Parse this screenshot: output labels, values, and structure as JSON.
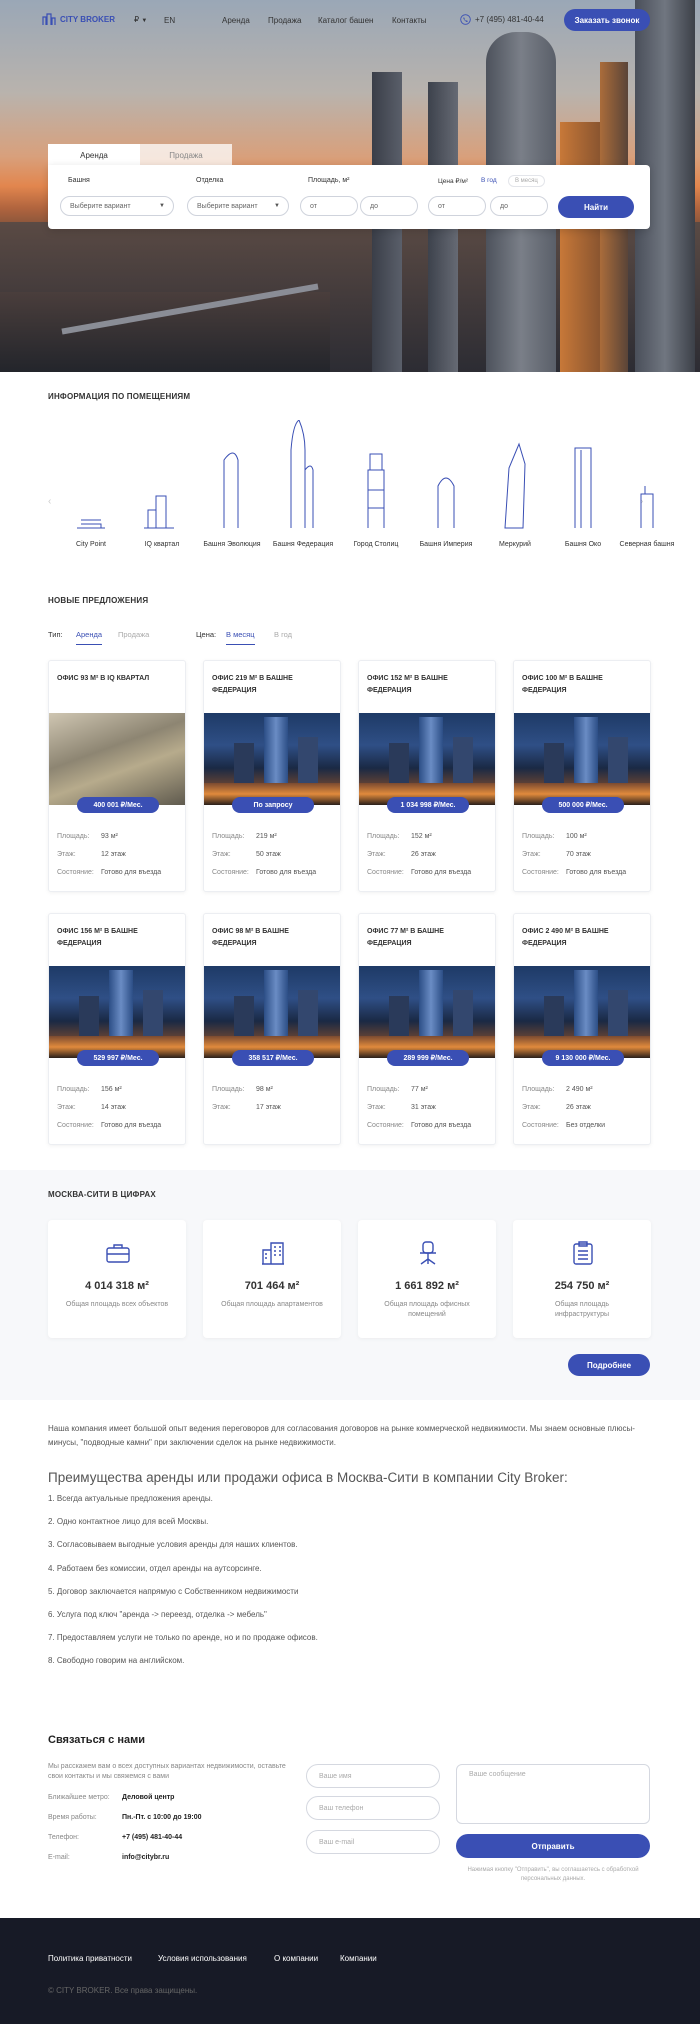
{
  "header": {
    "logo": "CITY BROKER",
    "lang": "EN",
    "nav": [
      "Аренда",
      "Продажа",
      "Каталог башен",
      "Контакты"
    ],
    "phone": "+7 (495) 481-40-44",
    "cta": "Заказать звонок"
  },
  "search": {
    "tabs": [
      "Аренда",
      "Продажа"
    ],
    "labels": {
      "tower": "Башня",
      "finish": "Отделка",
      "area": "Площадь, м²",
      "price": "Цена ₽/м²",
      "per_month": "В год",
      "per_year": "В месяц"
    },
    "placeholders": {
      "select": "Выберите вариант",
      "from": "от",
      "to": "до"
    },
    "submit": "Найти"
  },
  "towers": {
    "title": "ИНФОРМАЦИЯ ПО ПОМЕЩЕНИЯМ",
    "items": [
      "City Point",
      "IQ квартал",
      "Башня Эволюция",
      "Башня Федерация",
      "Город Столиц",
      "Башня Империя",
      "Меркурий",
      "Башня Око",
      "Северная башня"
    ]
  },
  "offers": {
    "title": "НОВЫЕ ПРЕДЛОЖЕНИЯ",
    "type_label": "Тип:",
    "type_tabs": [
      "Аренда",
      "Продажа"
    ],
    "price_label": "Цена:",
    "price_tabs": [
      "В месяц",
      "В год"
    ],
    "labels": {
      "area": "Площадь:",
      "floor": "Этаж:",
      "state": "Состояние:"
    },
    "cards": [
      {
        "title": "ОФИС 93 М² В IQ КВАРТАЛ",
        "price": "400 001 ₽/Мес.",
        "area": "93 м²",
        "floor": "12 этаж",
        "state": "Готово для въезда"
      },
      {
        "title": "ОФИС 219 М² В БАШНЕ ФЕДЕРАЦИЯ",
        "price": "По запросу",
        "area": "219 м²",
        "floor": "50 этаж",
        "state": "Готово для въезда"
      },
      {
        "title": "ОФИС 152 М² В БАШНЕ ФЕДЕРАЦИЯ",
        "price": "1 034 998 ₽/Мес.",
        "area": "152 м²",
        "floor": "26 этаж",
        "state": "Готово для въезда"
      },
      {
        "title": "ОФИС 100 М² В БАШНЕ ФЕДЕРАЦИЯ",
        "price": "500 000 ₽/Мес.",
        "area": "100 м²",
        "floor": "70 этаж",
        "state": "Готово для въезда"
      },
      {
        "title": "ОФИС 156 М² В БАШНЕ ФЕДЕРАЦИЯ",
        "price": "529 997 ₽/Мес.",
        "area": "156 м²",
        "floor": "14 этаж",
        "state": "Готово для въезда"
      },
      {
        "title": "ОФИС 98 М² В БАШНЕ ФЕДЕРАЦИЯ",
        "price": "358 517 ₽/Мес.",
        "area": "98 м²",
        "floor": "17 этаж",
        "state": ""
      },
      {
        "title": "ОФИС 77 М² В БАШНЕ ФЕДЕРАЦИЯ",
        "price": "289 999 ₽/Мес.",
        "area": "77 м²",
        "floor": "31 этаж",
        "state": "Готово для въезда"
      },
      {
        "title": "ОФИС 2 490 М² В БАШНЕ ФЕДЕРАЦИЯ",
        "price": "9 130 000 ₽/Мес.",
        "area": "2 490 м²",
        "floor": "26 этаж",
        "state": "Без отделки"
      }
    ]
  },
  "stats": {
    "title": "МОСКВА-СИТИ В ЦИФРАХ",
    "items": [
      {
        "value": "4 014 318 м²",
        "desc": "Общая площадь всех объектов"
      },
      {
        "value": "701 464 м²",
        "desc": "Общая площадь апартаментов"
      },
      {
        "value": "1 661 892 м²",
        "desc": "Общая площадь офисных помещений"
      },
      {
        "value": "254 750 м²",
        "desc": "Общая площадь инфраструктуры"
      }
    ],
    "more": "Подробнее"
  },
  "about": {
    "intro": "Наша компания имеет большой опыт ведения переговоров для согласования договоров на рынке коммерческой недвижимости. Мы знаем основные плюсы-минусы, \"подводные камни\" при заключении сделок на рынке недвижимости.",
    "heading": "Преимущества аренды или продажи офиса в Москва-Сити в компании City Broker:",
    "list": [
      "1. Всегда актуальные предложения аренды.",
      "2. Одно контактное лицо для всей Москвы.",
      "3. Согласовываем выгодные условия аренды для наших клиентов.",
      "4. Работаем без комиссии, отдел аренды на аутсорсинге.",
      "5. Договор заключается напрямую с Собственником недвижимости",
      "6. Услуга под ключ \"аренда -> переезд, отделка -> мебель\"",
      "7. Предоставляем услуги не только по аренде, но и по продаже офисов.",
      "8. Свободно говорим на английском."
    ]
  },
  "contact": {
    "title": "Связаться с нами",
    "desc": "Мы расскажем вам о всех доступных вариантах недвижимости, оставьте свои контакты и мы свяжемся с вами",
    "rows": [
      {
        "k": "Ближайшее метро:",
        "v": "Деловой центр"
      },
      {
        "k": "Время работы:",
        "v": "Пн.-Пт. с 10:00 до 19:00"
      },
      {
        "k": "Телефон:",
        "v": "+7 (495) 481-40-44"
      },
      {
        "k": "E-mail:",
        "v": "info@citybr.ru"
      }
    ],
    "ph": {
      "name": "Ваше имя",
      "phone": "Ваш телефон",
      "email": "Ваш e-mail",
      "message": "Ваше сообщение"
    },
    "send": "Отправить",
    "note": "Нажимая кнопку \"Отправить\", вы соглашаетесь с обработкой персональных данных."
  },
  "footer": {
    "links": [
      "Политика приватности",
      "Условия использования",
      "О компании",
      "Компании"
    ],
    "copy": "© CITY BROKER. Все права защищены."
  },
  "colors": {
    "accent": "#3a4fb4",
    "footer": "#171a26"
  }
}
